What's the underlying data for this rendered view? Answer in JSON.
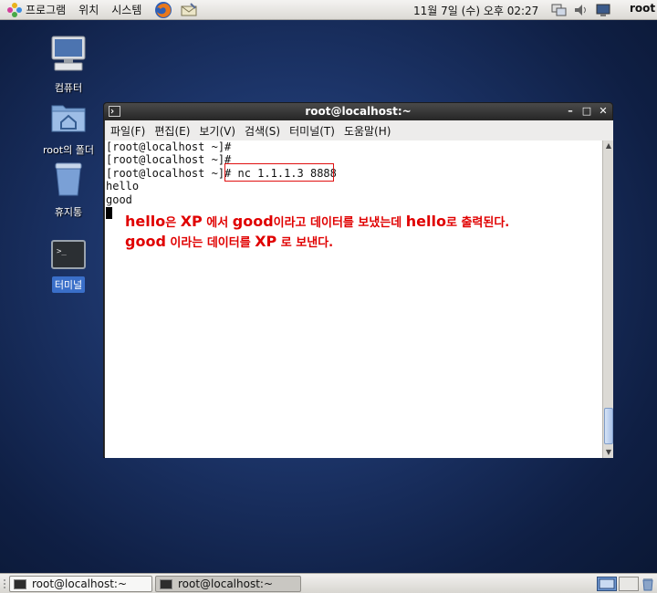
{
  "top_panel": {
    "menus": [
      "프로그램",
      "위치",
      "시스템"
    ],
    "clock": "11월  7일 (수) 오후 02:27",
    "user": "root"
  },
  "desktop": {
    "icons": [
      {
        "label": "컴퓨터",
        "icon": "computer-icon"
      },
      {
        "label": "root의 폴더",
        "icon": "home-folder-icon"
      },
      {
        "label": "휴지통",
        "icon": "trash-icon"
      },
      {
        "label": "터미널",
        "icon": "terminal-icon"
      }
    ]
  },
  "terminal": {
    "title": "root@localhost:~",
    "menu": [
      "파일(F)",
      "편집(E)",
      "보기(V)",
      "검색(S)",
      "터미널(T)",
      "도움말(H)"
    ],
    "lines": [
      "[root@localhost ~]#",
      "[root@localhost ~]#",
      "[root@localhost ~]# nc 1.1.1.3 8888",
      "hello",
      "good"
    ],
    "annotation": {
      "line1": {
        "a": "hello",
        "b": "은 ",
        "c": "XP",
        "d": " 에서 ",
        "e": "good",
        "f": "이라고 데이터를 보냈는데 ",
        "g": "hello",
        "h": "로 출력된다."
      },
      "line2": {
        "a": "good",
        "b": " 이라는 데이터를 ",
        "c": "XP",
        "d": " 로 보낸다."
      }
    }
  },
  "taskbar": {
    "items": [
      "root@localhost:~",
      "root@localhost:~"
    ]
  },
  "colors": {
    "annotation": "#e00000",
    "desktop_bg": "#1c3468",
    "titlebar": "#262626"
  }
}
